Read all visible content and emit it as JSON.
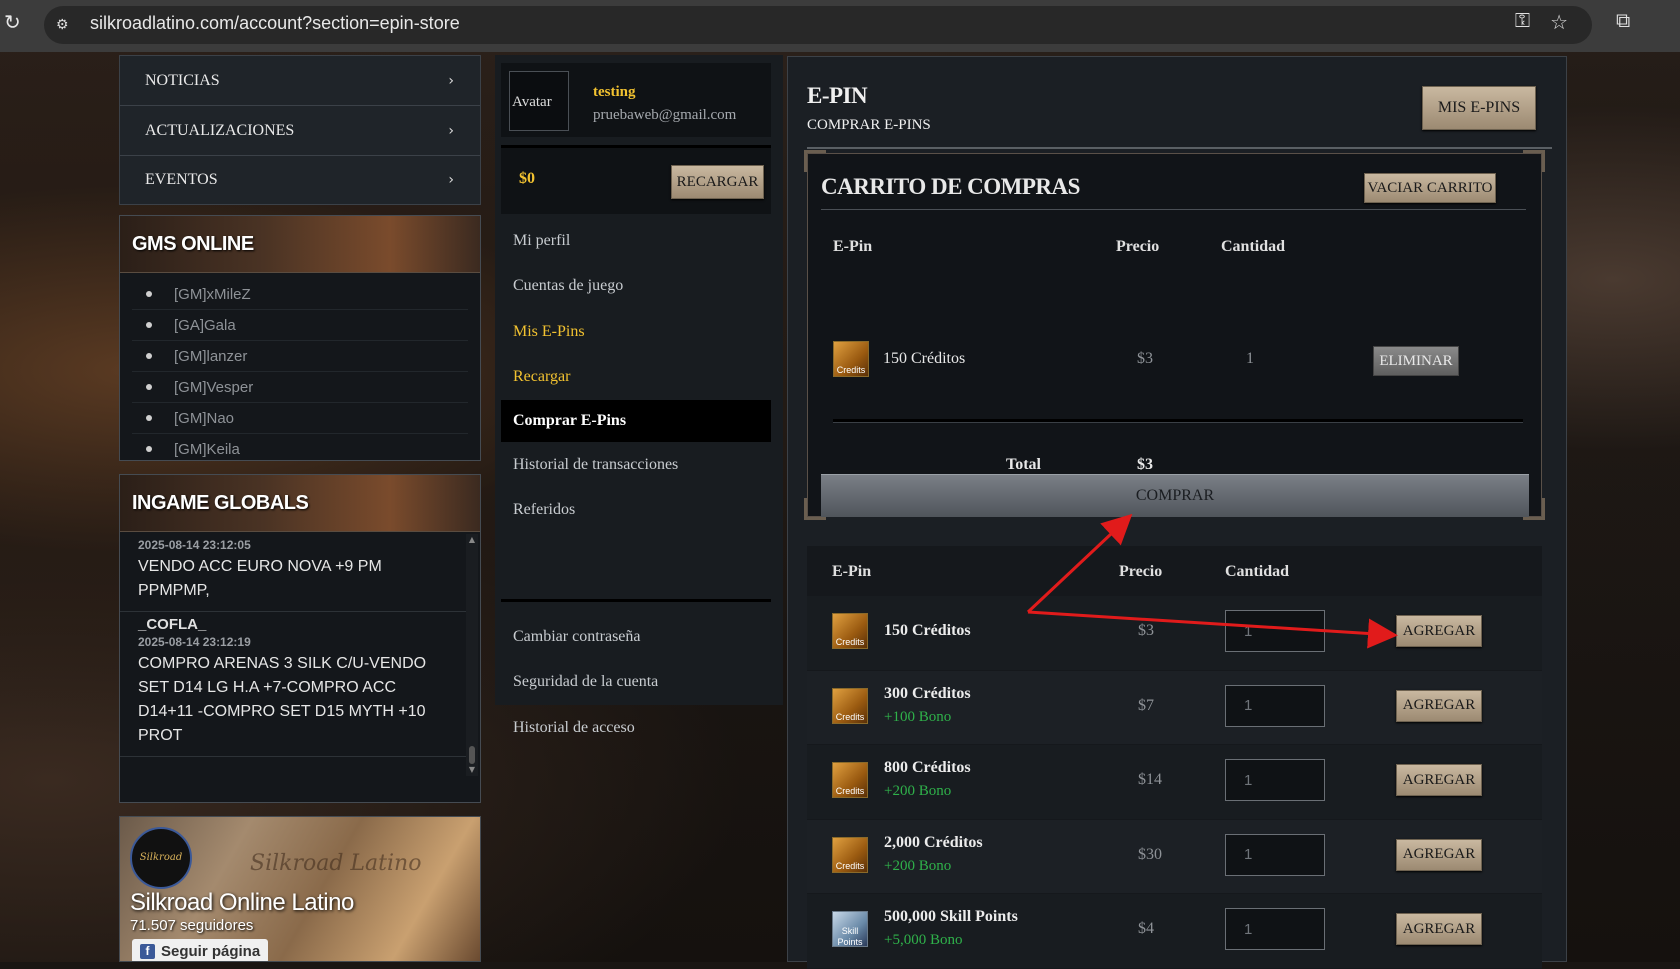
{
  "browser": {
    "url": "silkroadlatino.com/account?section=epin-store"
  },
  "left_nav": {
    "items": [
      {
        "label": "NOTICIAS"
      },
      {
        "label": "ACTUALIZACIONES"
      },
      {
        "label": "EVENTOS"
      }
    ]
  },
  "gms_online": {
    "title": "GMS ONLINE",
    "members": [
      "[GM]xMileZ",
      "[GA]Gala",
      "[GM]lanzer",
      "[GM]Vesper",
      "[GM]Nao",
      "[GM]Keila"
    ]
  },
  "ingame_globals": {
    "title": "INGAME GLOBALS",
    "entries": [
      {
        "name": "",
        "time": "2025-08-14 23:12:05",
        "message": "VENDO ACC EURO NOVA +9 PM PPMPMP,"
      },
      {
        "name": "_COFLA_",
        "time": "2025-08-14 23:12:19",
        "message": "COMPRO ARENAS 3 SILK C/U-VENDO SET D14 LG H.A +7-COMPRO ACC D14+11 -COMPRO SET D15 MYTH +10 PROT"
      }
    ]
  },
  "facebook": {
    "page_name": "Silkroad Online Latino",
    "followers": "71.507 seguidores",
    "follow_label": "Seguir página"
  },
  "account": {
    "avatar_label": "Avatar",
    "username": "testing",
    "email": "pruebaweb@gmail.com",
    "balance": "$0",
    "recharge_label": "RECARGAR",
    "menu": [
      {
        "label": "Mi perfil"
      },
      {
        "label": "Cuentas de juego"
      },
      {
        "label": "Mis E-Pins"
      },
      {
        "label": "Recargar"
      },
      {
        "label": "Comprar E-Pins"
      },
      {
        "label": "Historial de transacciones"
      },
      {
        "label": "Referidos"
      }
    ],
    "menu2": [
      {
        "label": "Cambiar contraseña"
      },
      {
        "label": "Seguridad de la cuenta"
      },
      {
        "label": "Historial de acceso"
      }
    ]
  },
  "epin": {
    "title": "E-PIN",
    "subtitle": "COMPRAR E-PINS",
    "my_epins_label": "MIS E-PINS"
  },
  "cart": {
    "title": "CARRITO DE COMPRAS",
    "empty_label": "VACIAR CARRITO",
    "headers": {
      "epin": "E-Pin",
      "price": "Precio",
      "qty": "Cantidad"
    },
    "items": [
      {
        "icon": "credits-icon",
        "icon_text": "Credits",
        "name": "150 Créditos",
        "price": "$3",
        "qty": "1",
        "remove_label": "ELIMINAR"
      }
    ],
    "total_label": "Total",
    "total_value": "$3",
    "buy_label": "COMPRAR"
  },
  "store": {
    "headers": {
      "epin": "E-Pin",
      "price": "Precio",
      "qty": "Cantidad"
    },
    "add_label": "AGREGAR",
    "items": [
      {
        "icon": "credits-icon",
        "icon_text": "Credits",
        "name": "150 Créditos",
        "bonus": "",
        "price": "$3",
        "qty": "1"
      },
      {
        "icon": "credits-icon",
        "icon_text": "Credits",
        "name": "300 Créditos",
        "bonus": "+100 Bono",
        "price": "$7",
        "qty": "1"
      },
      {
        "icon": "credits-icon",
        "icon_text": "Credits",
        "name": "800 Créditos",
        "bonus": "+200 Bono",
        "price": "$14",
        "qty": "1"
      },
      {
        "icon": "credits-icon",
        "icon_text": "Credits",
        "name": "2,000 Créditos",
        "bonus": "+200 Bono",
        "price": "$30",
        "qty": "1"
      },
      {
        "icon": "skill-points-icon",
        "icon_text": "Skill Points",
        "name": "500,000 Skill Points",
        "bonus": "+5,000 Bono",
        "price": "$4",
        "qty": "1"
      }
    ]
  },
  "colors": {
    "accent_gold": "#f2c230",
    "bonus_green": "#2fb14a",
    "annotation_red": "#e11b1b"
  }
}
